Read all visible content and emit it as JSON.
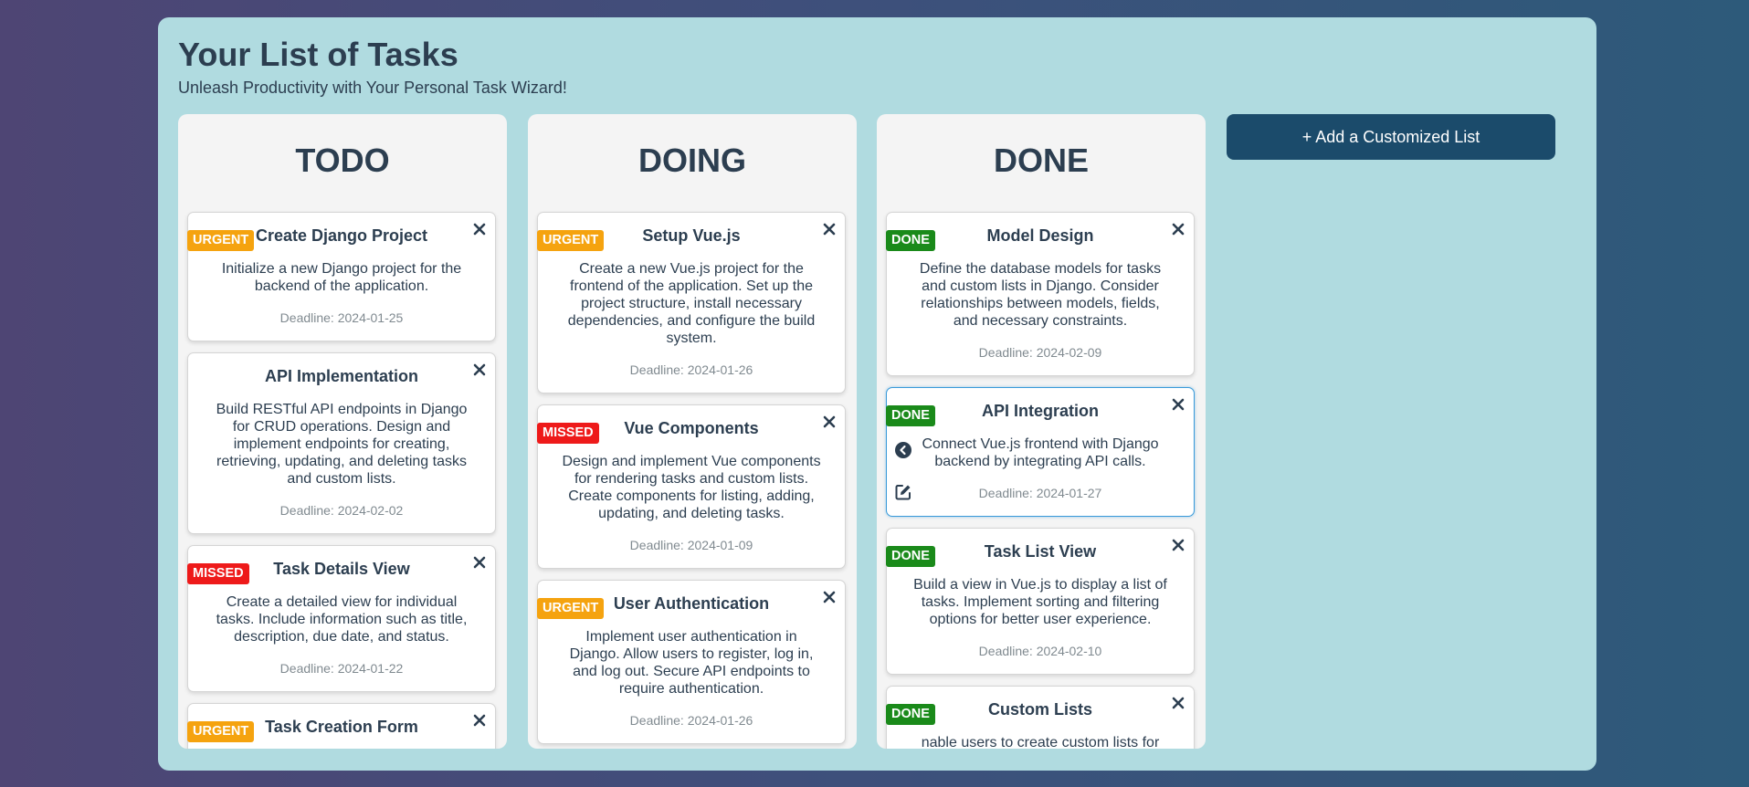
{
  "header": {
    "title": "Your List of Tasks",
    "subtitle": "Unleash Productivity with Your Personal Task Wizard!"
  },
  "add_list_label": "+ Add a Customized List",
  "colors": {
    "urgent": "#f5a30f",
    "missed": "#ee1a1a",
    "done": "#1a8a1a",
    "panel": "#b0dbe0",
    "button": "#1b4b6b"
  },
  "columns": [
    {
      "title": "TODO",
      "cards": [
        {
          "badge": "URGENT",
          "title": "Create Django Project",
          "description": "Initialize a new Django project for the backend of the application.",
          "deadline": "Deadline: 2024-01-25"
        },
        {
          "badge": "",
          "title": "API Implementation",
          "description": "Build RESTful API endpoints in Django for CRUD operations. Design and implement endpoints for creating, retrieving, updating, and deleting tasks and custom lists.",
          "deadline": "Deadline: 2024-02-02"
        },
        {
          "badge": "MISSED",
          "title": "Task Details View",
          "description": "Create a detailed view for individual tasks. Include information such as title, description, due date, and status.",
          "deadline": "Deadline: 2024-01-22"
        },
        {
          "badge": "URGENT",
          "title": "Task Creation Form",
          "description": "",
          "deadline": ""
        }
      ]
    },
    {
      "title": "DOING",
      "cards": [
        {
          "badge": "URGENT",
          "title": "Setup Vue.js",
          "description": "Create a new Vue.js project for the frontend of the application. Set up the project structure, install necessary dependencies, and configure the build system.",
          "deadline": "Deadline: 2024-01-26"
        },
        {
          "badge": "MISSED",
          "title": "Vue Components",
          "description": "Design and implement Vue components for rendering tasks and custom lists. Create components for listing, adding, updating, and deleting tasks.",
          "deadline": "Deadline: 2024-01-09"
        },
        {
          "badge": "URGENT",
          "title": "User Authentication",
          "description": "Implement user authentication in Django. Allow users to register, log in, and log out. Secure API endpoints to require authentication.",
          "deadline": "Deadline: 2024-01-26"
        }
      ]
    },
    {
      "title": "DONE",
      "cards": [
        {
          "badge": "DONE",
          "title": "Model Design",
          "description": "Define the database models for tasks and custom lists in Django. Consider relationships between models, fields, and necessary constraints.",
          "deadline": "Deadline: 2024-02-09"
        },
        {
          "badge": "DONE",
          "title": "API Integration",
          "description": "Connect Vue.js frontend with Django backend by integrating API calls.",
          "deadline": "Deadline: 2024-01-27"
        },
        {
          "badge": "DONE",
          "title": "Task List View",
          "description": "Build a view in Vue.js to display a list of tasks. Implement sorting and filtering options for better user experience.",
          "deadline": "Deadline: 2024-02-10"
        },
        {
          "badge": "DONE",
          "title": "Custom Lists",
          "description": "nable users to create custom lists for",
          "deadline": ""
        }
      ]
    }
  ]
}
